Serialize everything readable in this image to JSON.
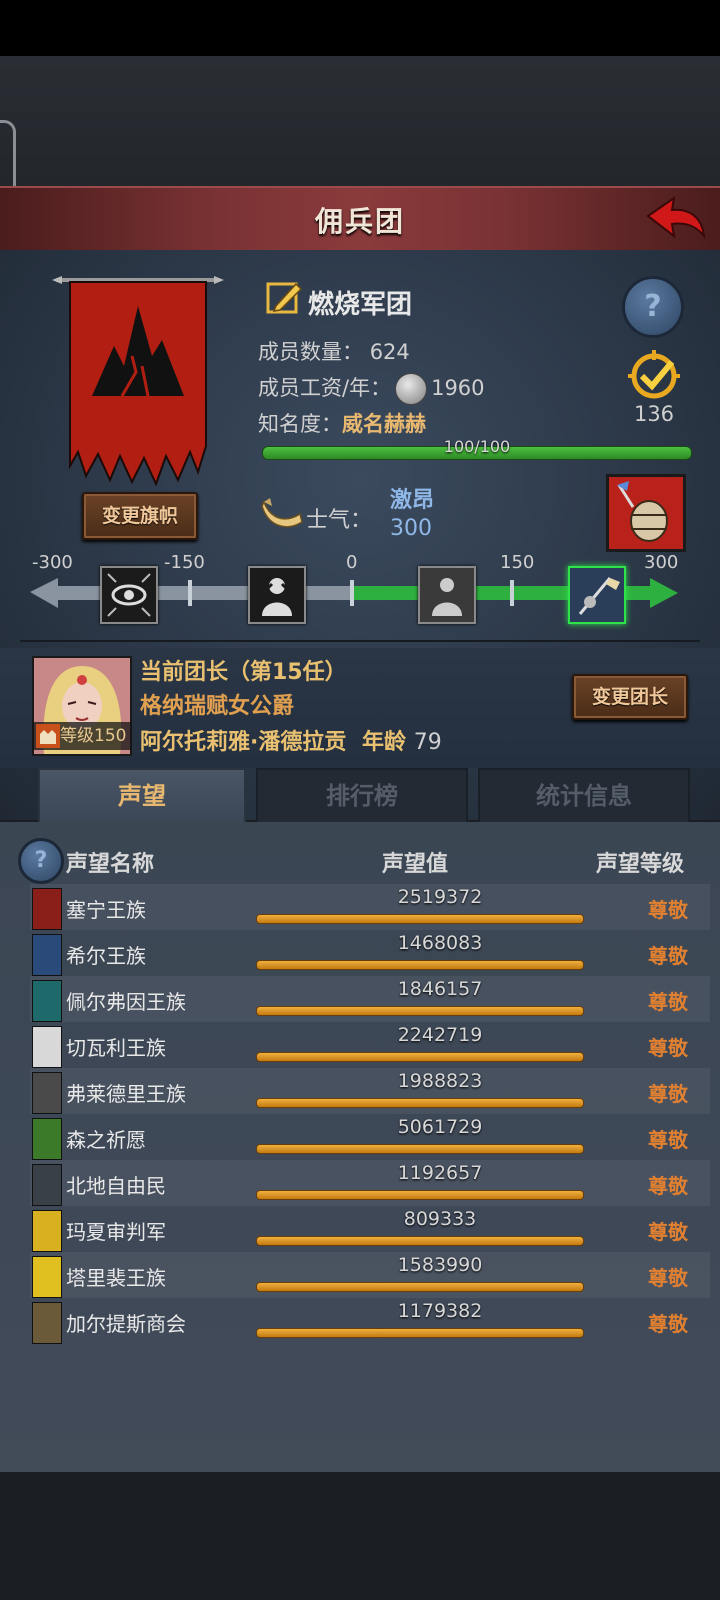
{
  "header": {
    "title": "佣兵团"
  },
  "group": {
    "name": "燃烧军团",
    "members_label": "成员数量：",
    "members": "624",
    "salary_label": "成员工资/年：",
    "salary": "1960",
    "fame_label": "知名度：",
    "fame_value": "威名赫赫",
    "fame_progress": "100/100",
    "fame_fraction": 1.0,
    "target_count": "136",
    "change_flag_label": "变更旗帜"
  },
  "morale": {
    "label": "士气：",
    "state": "激昂",
    "value": "300",
    "scale_labels": [
      "-300",
      "-150",
      "0",
      "150",
      "300"
    ]
  },
  "leader": {
    "title": "当前团长（第15任）",
    "rank": "格纳瑞赋女公爵",
    "name": "阿尔托莉雅·潘德拉贡",
    "age_label": "年龄",
    "age": "79",
    "level_label": "等级150",
    "change_label": "变更团长"
  },
  "tabs": {
    "reputation": "声望",
    "ranking": "排行榜",
    "stats": "统计信息"
  },
  "table": {
    "headers": {
      "name": "声望名称",
      "value": "声望值",
      "level": "声望等级"
    },
    "rows": [
      {
        "name": "塞宁王族",
        "value": "2519372",
        "level": "尊敬",
        "color": "#8a1e18"
      },
      {
        "name": "希尔王族",
        "value": "1468083",
        "level": "尊敬",
        "color": "#2a4a7a"
      },
      {
        "name": "佩尔弗因王族",
        "value": "1846157",
        "level": "尊敬",
        "color": "#1e6a6a"
      },
      {
        "name": "切瓦利王族",
        "value": "2242719",
        "level": "尊敬",
        "color": "#d8d8d8"
      },
      {
        "name": "弗莱德里王族",
        "value": "1988823",
        "level": "尊敬",
        "color": "#4a4a4a"
      },
      {
        "name": "森之祈愿",
        "value": "5061729",
        "level": "尊敬",
        "color": "#3a7a28"
      },
      {
        "name": "北地自由民",
        "value": "1192657",
        "level": "尊敬",
        "color": "#3a4048"
      },
      {
        "name": "玛夏审判军",
        "value": "809333",
        "level": "尊敬",
        "color": "#d8b020"
      },
      {
        "name": "塔里裴王族",
        "value": "1583990",
        "level": "尊敬",
        "color": "#e0c020"
      },
      {
        "name": "加尔提斯商会",
        "value": "1179382",
        "level": "尊敬",
        "color": "#6a5a3a"
      }
    ]
  }
}
